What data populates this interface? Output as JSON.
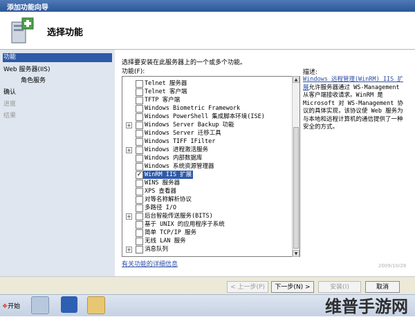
{
  "window": {
    "title": "添加功能向导"
  },
  "header": {
    "title": "选择功能"
  },
  "nav": {
    "items": [
      {
        "label": "功能",
        "state": "selected"
      },
      {
        "label": "Web 服务器(IIS)",
        "state": "normal"
      },
      {
        "label": "角色服务",
        "state": "normal"
      },
      {
        "label": "确认",
        "state": "normal"
      },
      {
        "label": "进度",
        "state": "disabled"
      },
      {
        "label": "结果",
        "state": "disabled"
      }
    ]
  },
  "content": {
    "instruction": "选择要安装在此服务器上的一个或多个功能。",
    "features_label": "功能(F):",
    "features": [
      {
        "label": "Telnet 服务器",
        "checked": false,
        "expandable": false
      },
      {
        "label": "Telnet 客户端",
        "checked": false,
        "expandable": false
      },
      {
        "label": "TFTP 客户端",
        "checked": false,
        "expandable": false
      },
      {
        "label": "Windows Biometric Framework",
        "checked": false,
        "expandable": false
      },
      {
        "label": "Windows PowerShell 集成脚本环境(ISE)",
        "checked": false,
        "expandable": false
      },
      {
        "label": "Windows Server Backup 功能",
        "checked": false,
        "expandable": true
      },
      {
        "label": "Windows Server 迁移工具",
        "checked": false,
        "expandable": false
      },
      {
        "label": "Windows TIFF IFilter",
        "checked": false,
        "expandable": false
      },
      {
        "label": "Windows 进程激活服务",
        "checked": false,
        "expandable": true
      },
      {
        "label": "Windows 内部数据库",
        "checked": false,
        "expandable": false
      },
      {
        "label": "Windows 系统资源管理器",
        "checked": false,
        "expandable": false
      },
      {
        "label": "WinRM IIS 扩展",
        "checked": true,
        "expandable": false,
        "highlighted": true
      },
      {
        "label": "WINS 服务器",
        "checked": false,
        "expandable": false
      },
      {
        "label": "XPS 查看器",
        "checked": false,
        "expandable": false
      },
      {
        "label": "对等名称解析协议",
        "checked": false,
        "expandable": false
      },
      {
        "label": "多路径 I/O",
        "checked": false,
        "expandable": false
      },
      {
        "label": "后台智能传送服务(BITS)",
        "checked": false,
        "expandable": true
      },
      {
        "label": "基于 UNIX 的应用程序子系统",
        "checked": false,
        "expandable": false
      },
      {
        "label": "简单 TCP/IP 服务",
        "checked": false,
        "expandable": false
      },
      {
        "label": "无线 LAN 服务",
        "checked": false,
        "expandable": false
      },
      {
        "label": "消息队列",
        "checked": false,
        "expandable": true
      }
    ],
    "more_info_link": "有关功能的详细信息",
    "description_heading": "描述:",
    "description_link": "Windows 远程管理(WinRM) IIS 扩展",
    "description_text": "允许服务器通过 WS-Management 从客户端接收请求。WinRM 是 Microsoft 对 WS-Management 协议的具体实现，该协议使 Web 服务为与本地和远程计算机的通信提供了一种安全的方式。",
    "date": "2009/10/28"
  },
  "buttons": {
    "prev": "< 上一步(P)",
    "next": "下一步(N) >",
    "install": "安装(I)",
    "cancel": "取消"
  },
  "taskbar": {
    "start_label": "开始",
    "watermark": "维普手游网"
  },
  "colors": {
    "selection": "#2f5aa8",
    "nav_bg": "#dfe6ef",
    "titlebar": "#2b5797"
  }
}
